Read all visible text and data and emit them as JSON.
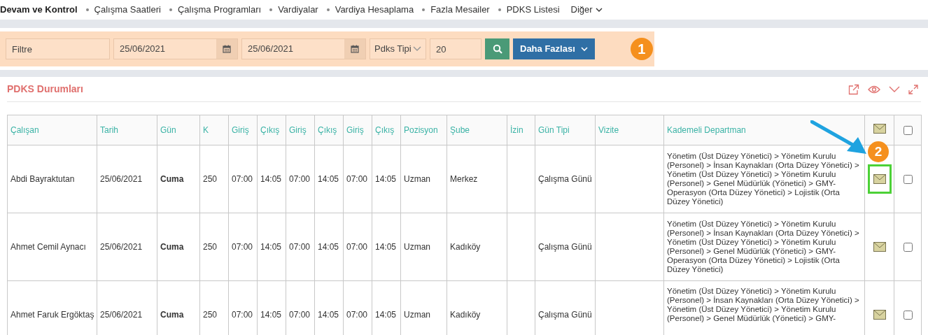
{
  "nav": {
    "items": [
      {
        "label": "Devam ve Kontrol",
        "selected": true
      },
      {
        "label": "Çalışma Saatleri",
        "selected": false
      },
      {
        "label": "Çalışma Programları",
        "selected": false
      },
      {
        "label": "Vardiyalar",
        "selected": false
      },
      {
        "label": "Vardiya Hesaplama",
        "selected": false
      },
      {
        "label": "Fazla Mesailer",
        "selected": false
      },
      {
        "label": "PDKS Listesi",
        "selected": false
      }
    ],
    "more": "Diğer"
  },
  "filter": {
    "fields": [
      {
        "kind": "text",
        "placeholder": "Filtre"
      },
      {
        "kind": "date",
        "value": "25/06/2021"
      },
      {
        "kind": "date",
        "value": "25/06/2021"
      },
      {
        "kind": "select",
        "value": "Pdks Tipi"
      },
      {
        "kind": "number",
        "value": "20"
      }
    ],
    "more_button": "Daha Fazlası",
    "badge": "1"
  },
  "panel": {
    "title": "PDKS Durumları",
    "columns": [
      "Çalışan",
      "Tarih",
      "Gün",
      "K",
      "Giriş",
      "Çıkış",
      "Giriş",
      "Çıkış",
      "Giriş",
      "Çıkış",
      "Pozisyon",
      "Şube",
      "İzin",
      "Gün Tipi",
      "Vizite",
      "Kademeli Departman"
    ],
    "header_checked": false,
    "rows": [
      {
        "employee": "Abdi Bayraktutan",
        "date": "25/06/2021",
        "day": "Cuma",
        "k": "250",
        "times": [
          "07:00",
          "14:05",
          "07:00",
          "14:05",
          "07:00",
          "14:05"
        ],
        "position": "Uzman",
        "branch": "Merkez",
        "day_type": "Çalışma Günü",
        "department": "Yönetim (Üst Düzey Yönetici) > Yönetim Kurulu (Personel) > İnsan Kaynakları (Orta Düzey Yönetici) > Yönetim (Üst Düzey Yönetici) > Yönetim Kurulu (Personel) > Genel Müdürlük (Yönetici) > GMY-Operasyon (Orta Düzey Yönetici) > Lojistik (Orta Düzey Yönetici)",
        "highlighted": true,
        "checked": false
      },
      {
        "employee": "Ahmet Cemil Aynacı",
        "date": "25/06/2021",
        "day": "Cuma",
        "k": "250",
        "times": [
          "07:00",
          "14:05",
          "07:00",
          "14:05",
          "07:00",
          "14:05"
        ],
        "position": "Uzman",
        "branch": "Kadıköy",
        "day_type": "Çalışma Günü",
        "department": "Yönetim (Üst Düzey Yönetici) > Yönetim Kurulu (Personel) > İnsan Kaynakları (Orta Düzey Yönetici) > Yönetim (Üst Düzey Yönetici) > Yönetim Kurulu (Personel) > Genel Müdürlük (Yönetici) > GMY-Operasyon (Orta Düzey Yönetici) > Lojistik (Orta Düzey Yönetici)",
        "highlighted": false,
        "checked": false
      },
      {
        "employee": "Ahmet Faruk Ergöktaş",
        "date": "25/06/2021",
        "day": "Cuma",
        "k": "250",
        "times": [
          "07:00",
          "14:05",
          "07:00",
          "14:05",
          "07:00",
          "14:05"
        ],
        "position": "Uzman",
        "branch": "Kadıköy",
        "day_type": "Çalışma Günü",
        "department": "Yönetim (Üst Düzey Yönetici) > Yönetim Kurulu (Personel) > İnsan Kaynakları (Orta Düzey Yönetici) > Yönetim (Üst Düzey Yönetici) > Yönetim Kurulu (Personel) > Genel Müdürlük (Yönetici) > GMY-",
        "highlighted": false,
        "checked": false
      }
    ],
    "badge": "2"
  }
}
